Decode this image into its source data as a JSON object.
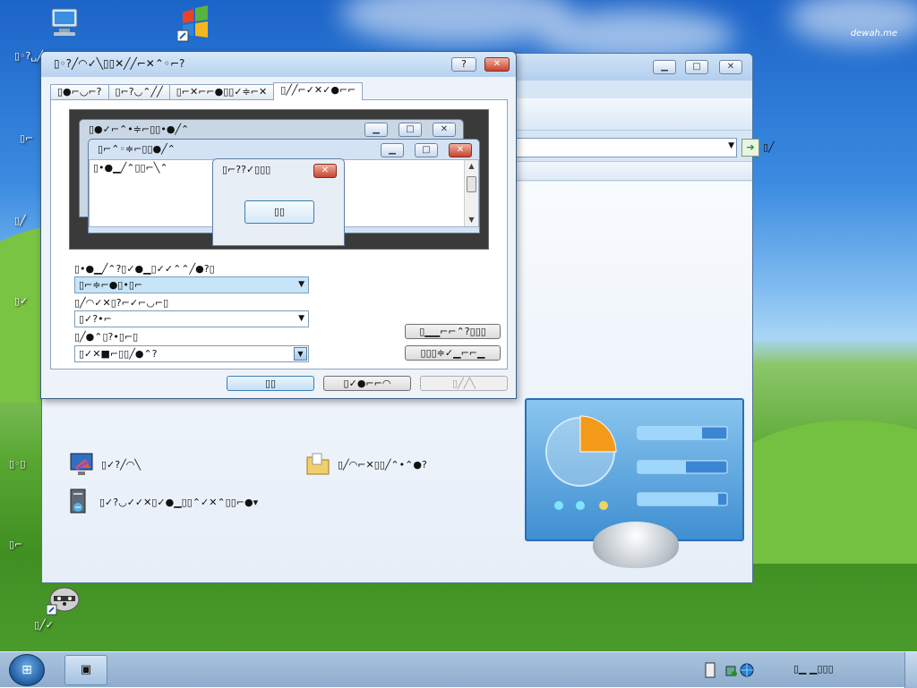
{
  "desktop": {
    "watermark": "dewah.me",
    "icons": [
      {
        "id": "computer",
        "label": "▯◦?␣╱◠"
      },
      {
        "id": "windows",
        "label": "▯▯"
      },
      {
        "id": "left2",
        "label": "▯⌐"
      },
      {
        "id": "left3",
        "label": "▯╱"
      },
      {
        "id": "left4",
        "label": "▯✓"
      },
      {
        "id": "left5",
        "label": "▯◦▯"
      },
      {
        "id": "left6",
        "label": "▯⌐"
      },
      {
        "id": "bottom",
        "label": "▯╱✓"
      }
    ]
  },
  "back_window": {
    "address_extra": "▯╱"
  },
  "control_panel_items": [
    {
      "label": "▯✓?╱◠╲"
    },
    {
      "label": "▯✓?◡✓✓✕▯✓●▁▯▯⌃✓✕⌃▯▯⌐●▾"
    },
    {
      "label": "▯╱◠⌐✕▯▯╱⌃•⌃●?"
    }
  ],
  "dialog": {
    "title": "▯◦?╱◠✓╲▯▯✕╱╱⌐✕⌃◦⌐?",
    "help_button": "?",
    "close_button": "✕",
    "tabs": [
      {
        "label": "▯●⌐◡⌐?"
      },
      {
        "label": "▯⌐?◡⌃╱╱"
      },
      {
        "label": "▯⌐✕⌐⌐●▯▯✓≑⌐✕"
      },
      {
        "label": "▯╱╱⌐✓✕✓●⌐⌐",
        "active": true
      }
    ],
    "preview": {
      "inactive_title": "▯●✓⌐⌃•≑⌐▯▯•●╱⌃",
      "active_title": "▯⌐⌃◦≑⌐▯▯●╱⌃",
      "text": "▯•●▁╱⌃▯▯⌐╲⌃",
      "msgbox_title": "▯⌐??✓▯▯▯",
      "ok": "▯▯"
    },
    "item_label": "▯•●▁╱⌃?▯✓●▁▯✓✓⌃⌃╱●?▯",
    "item_value": "▯⌐≑⌐●▯•▯⌐",
    "color1_label": "▯╱◠✓✕▯?⌐✓⌐◡⌐▯",
    "color1_value": "▯✓?•⌐",
    "font_label": "▯╱●⌃▯?•▯⌐▯",
    "font_value": "▯✓✕■⌐▯▯╱●⌃?",
    "side_buttons": [
      "▯▁▁⌐⌐⌃?▯▯▯",
      "▯▯▯≑✓▁⌐⌐▁"
    ],
    "buttons": {
      "ok": "▯▯",
      "cancel": "▯✓●⌐⌐◠",
      "apply": "▯╱╱╲"
    }
  },
  "taskbar": {
    "start": "⊞",
    "task_label": "▣",
    "clock": "▯▁ ▁▯▯▯"
  }
}
